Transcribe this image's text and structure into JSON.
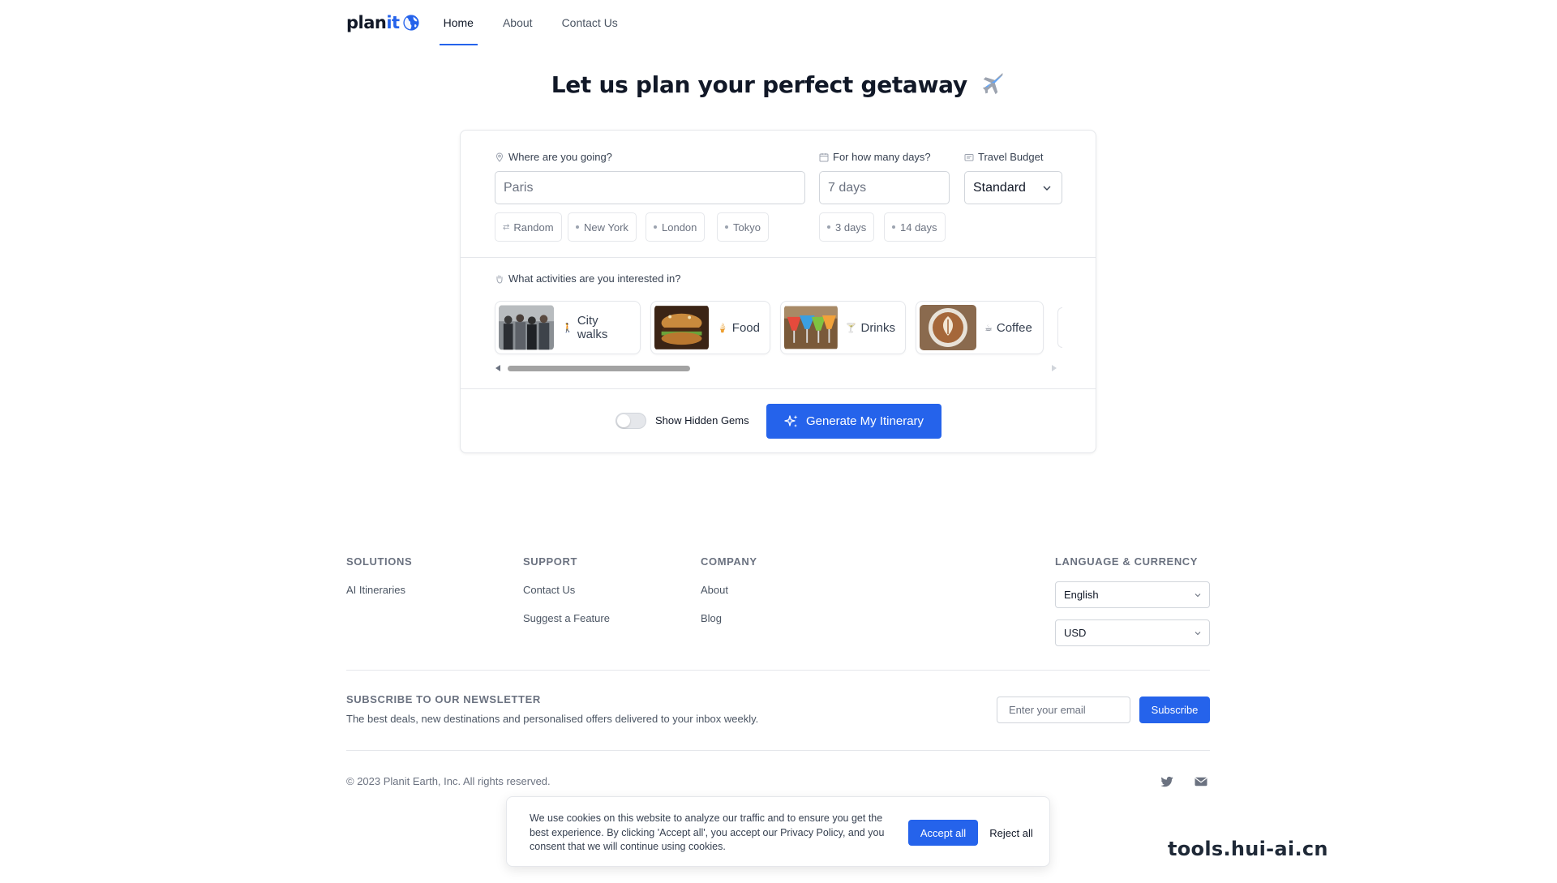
{
  "nav": {
    "logo_plan": "plan",
    "logo_it": "it",
    "links": [
      "Home",
      "About",
      "Contact Us"
    ],
    "active": "Home"
  },
  "hero": {
    "title": "Let us plan your perfect getaway"
  },
  "planner": {
    "destination": {
      "label": "Where are you going?",
      "value": "Paris",
      "suggestions": [
        "Random",
        "New York",
        "London",
        "Tokyo"
      ]
    },
    "days": {
      "label": "For how many days?",
      "placeholder": "7 days",
      "suggestions": [
        "3 days",
        "14 days"
      ]
    },
    "budget": {
      "label": "Travel Budget",
      "value": "Standard"
    },
    "activities": {
      "label": "What activities are you interested in?",
      "items": [
        {
          "label": "City walks",
          "icon": "walking-icon"
        },
        {
          "label": "Food",
          "icon": "food-icon"
        },
        {
          "label": "Drinks",
          "icon": "cocktail-icon"
        },
        {
          "label": "Coffee",
          "icon": "coffee-icon"
        }
      ]
    },
    "hidden_gems_label": "Show Hidden Gems",
    "hidden_gems_on": false,
    "generate_label": "Generate My Itinerary"
  },
  "footer": {
    "solutions": {
      "heading": "SOLUTIONS",
      "links": [
        "AI Itineraries"
      ]
    },
    "support": {
      "heading": "SUPPORT",
      "links": [
        "Contact Us",
        "Suggest a Feature"
      ]
    },
    "company": {
      "heading": "COMPANY",
      "links": [
        "About",
        "Blog"
      ]
    },
    "language_currency": {
      "heading": "LANGUAGE & CURRENCY",
      "language": "English",
      "currency": "USD"
    },
    "newsletter": {
      "heading": "SUBSCRIBE TO OUR NEWSLETTER",
      "description": "The best deals, new destinations and personalised offers delivered to your inbox weekly.",
      "placeholder": "Enter your email",
      "button": "Subscribe"
    },
    "copyright": "© 2023 Planit Earth, Inc. All rights reserved."
  },
  "cookie": {
    "text": "We use cookies on this website to analyze our traffic and to ensure you get the best experience. By clicking 'Accept all', you accept our Privacy Policy, and you consent that we will continue using cookies.",
    "accept": "Accept all",
    "reject": "Reject all"
  },
  "watermark": "tools.hui-ai.cn",
  "colors": {
    "accent": "#2563eb",
    "text": "#111827",
    "muted": "#6b7280",
    "border": "#e5e7eb"
  }
}
